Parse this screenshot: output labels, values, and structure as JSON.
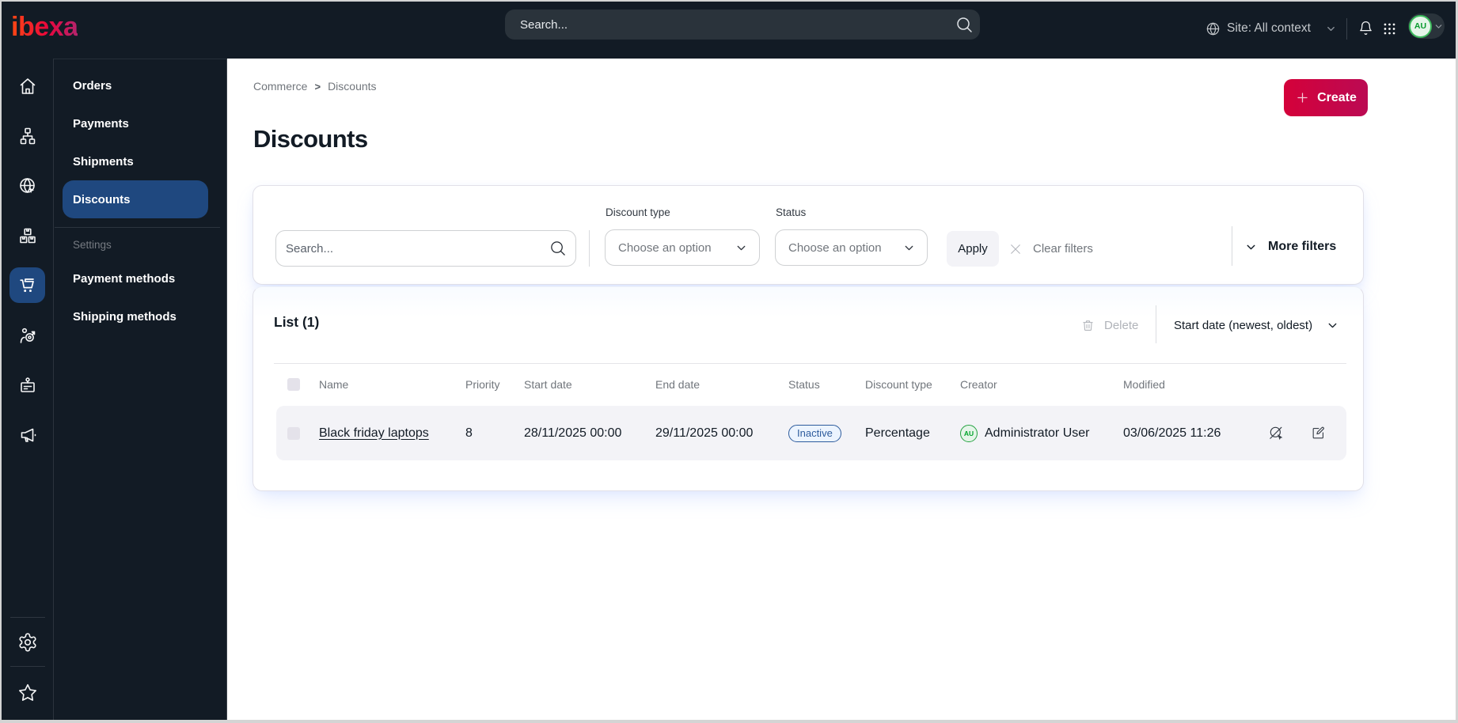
{
  "topbar": {
    "logo_text": "ibexa",
    "search_placeholder": "Search...",
    "site_context_label": "Site: All context",
    "avatar_initials": "AU"
  },
  "sidebar_icons": [
    "home-icon",
    "content-tree-icon",
    "site-globe-icon",
    "products-boxes-icon",
    "commerce-cart-icon",
    "customers-target-icon",
    "corporate-badge-icon",
    "marketing-megaphone-icon",
    "settings-gear-icon",
    "bookmarks-star-icon"
  ],
  "sidebar_active": "commerce-cart-icon",
  "menu": {
    "items": [
      "Orders",
      "Payments",
      "Shipments",
      "Discounts"
    ],
    "active_item": "Discounts",
    "settings_label": "Settings",
    "settings_items": [
      "Payment methods",
      "Shipping methods"
    ]
  },
  "breadcrumb": {
    "items": [
      "Commerce",
      "Discounts"
    ],
    "separator": ">"
  },
  "page": {
    "title": "Discounts",
    "create_label": "Create"
  },
  "filters": {
    "search_placeholder": "Search...",
    "discount_type_label": "Discount type",
    "discount_type_value": "Choose an option",
    "status_label": "Status",
    "status_value": "Choose an option",
    "apply_label": "Apply",
    "clear_label": "Clear filters",
    "more_filters_label": "More filters"
  },
  "list": {
    "title": "List (1)",
    "delete_label": "Delete",
    "sort_label": "Start date (newest, oldest)",
    "columns": [
      "Name",
      "Priority",
      "Start date",
      "End date",
      "Status",
      "Discount type",
      "Creator",
      "Modified"
    ],
    "rows": [
      {
        "name": "Black friday laptops",
        "priority": "8",
        "start_date": "28/11/2025 00:00",
        "end_date": "29/11/2025 00:00",
        "status": "Inactive",
        "discount_type": "Percentage",
        "creator": "Administrator User",
        "creator_initials": "AU",
        "modified": "03/06/2025 11:26"
      }
    ]
  },
  "colors": {
    "topbar_bg": "#121b25",
    "active_blue": "#1f487f",
    "accent_red": "#d4013a",
    "accent_magenta": "#bb0a53",
    "status_badge_blue": "#2d5b9c",
    "avatar_green": "#01a42b",
    "row_bg": "#f3f3f7"
  }
}
